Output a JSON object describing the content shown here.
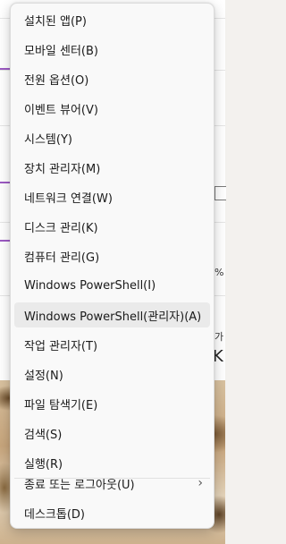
{
  "context_menu": {
    "items": [
      {
        "label": "설치된 앱(P)"
      },
      {
        "label": "모바일 센터(B)"
      },
      {
        "label": "전원 옵션(O)"
      },
      {
        "label": "이벤트 뷰어(V)"
      },
      {
        "label": "시스템(Y)"
      },
      {
        "label": "장치 관리자(M)"
      },
      {
        "label": "네트워크 연결(W)"
      },
      {
        "label": "디스크 관리(K)"
      },
      {
        "label": "컴퓨터 관리(G)"
      },
      {
        "label": "Windows PowerShell(I)"
      },
      {
        "label": "Windows PowerShell(관리자)(A)",
        "highlighted": true
      },
      {
        "label": "작업 관리자(T)"
      },
      {
        "label": "설정(N)"
      },
      {
        "label": "파일 탐색기(E)"
      },
      {
        "label": "검색(S)"
      },
      {
        "label": "실행(R)"
      },
      {
        "label": "종료 또는 로그아웃(U)",
        "submenu_icon": "chevron-right-icon"
      },
      {
        "label": "데스크톱(D)"
      }
    ],
    "highlight_color": "#eaeaea"
  },
  "background": {
    "percent_fragment": "%",
    "text_fragment": "가",
    "large_fragment": "K"
  }
}
